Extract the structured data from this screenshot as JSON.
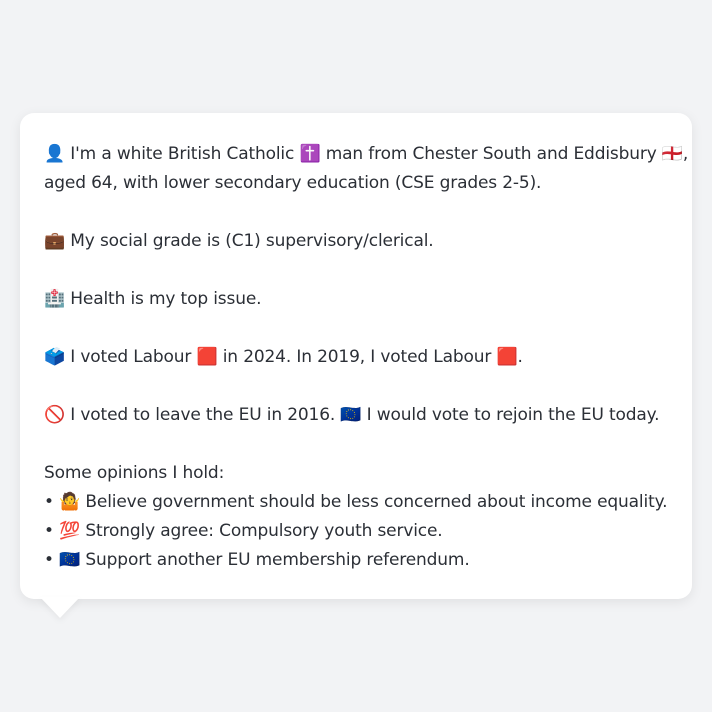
{
  "profile": {
    "identity_line1": "👤 I'm a white British Catholic ✝️ man from Chester South and Eddisbury 🏴󠁧󠁢󠁥󠁮󠁧󠁿,",
    "identity_line2": "aged 64, with lower secondary education (CSE grades 2-5).",
    "social_grade": "💼 My social grade is (C1) supervisory/clerical.",
    "top_issue": "🏥 Health is my top issue.",
    "vote_history": "🗳️ I voted Labour 🟥 in 2024. In 2019, I voted Labour 🟥.",
    "eu_stance": "🚫 I voted to leave the EU in 2016. 🇪🇺 I would vote to rejoin the EU today.",
    "opinions_heading": "Some opinions I hold:",
    "opinions": [
      "• 🤷 Believe government should be less concerned about income equality.",
      "• 💯 Strongly agree: Compulsory youth service.",
      "• 🇪🇺 Support another EU membership referendum."
    ]
  }
}
